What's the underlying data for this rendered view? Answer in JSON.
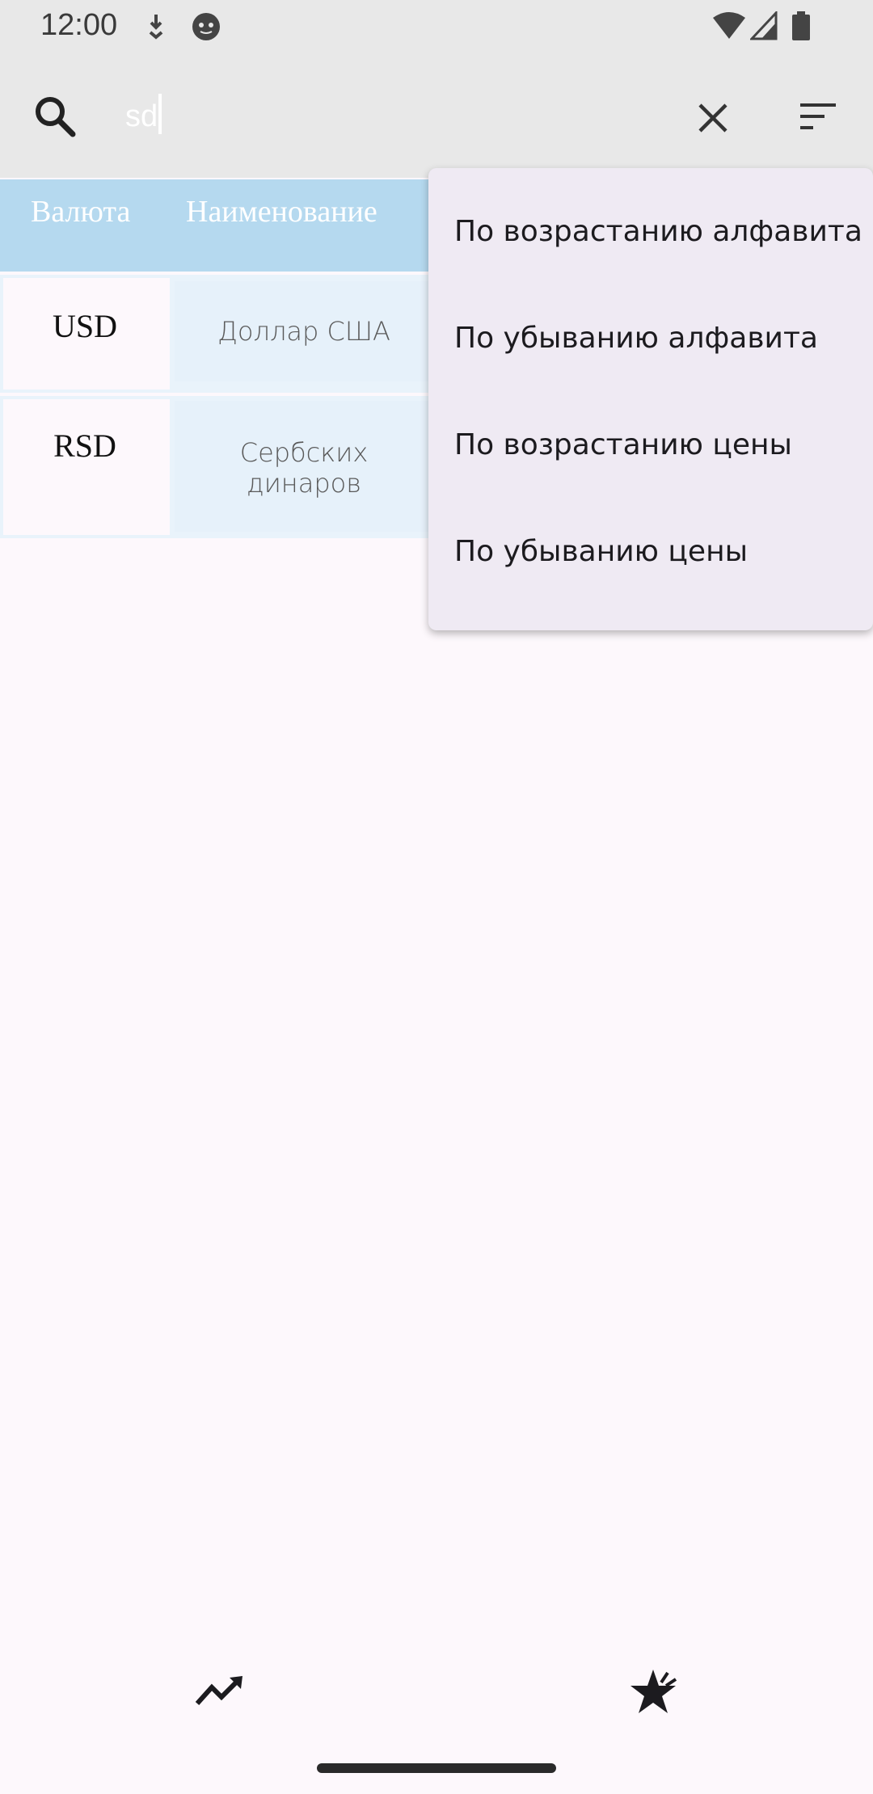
{
  "status_bar": {
    "time": "12:00"
  },
  "search": {
    "value": "sd"
  },
  "table": {
    "headers": [
      "Валюта",
      "Наименование"
    ],
    "rows": [
      {
        "code": "USD",
        "name": "Доллар США"
      },
      {
        "code": "RSD",
        "name_line1": "Сербских",
        "name_line2": "динаров"
      }
    ]
  },
  "sort_menu": {
    "items": [
      "По возрастанию алфавита",
      "По убыванию алфавита",
      "По возрастанию цены",
      "По убыванию цены"
    ]
  },
  "colors": {
    "header_bg": "#b5d9ef",
    "menu_bg": "#efeaf3",
    "page_bg": "#fdf8fc"
  }
}
